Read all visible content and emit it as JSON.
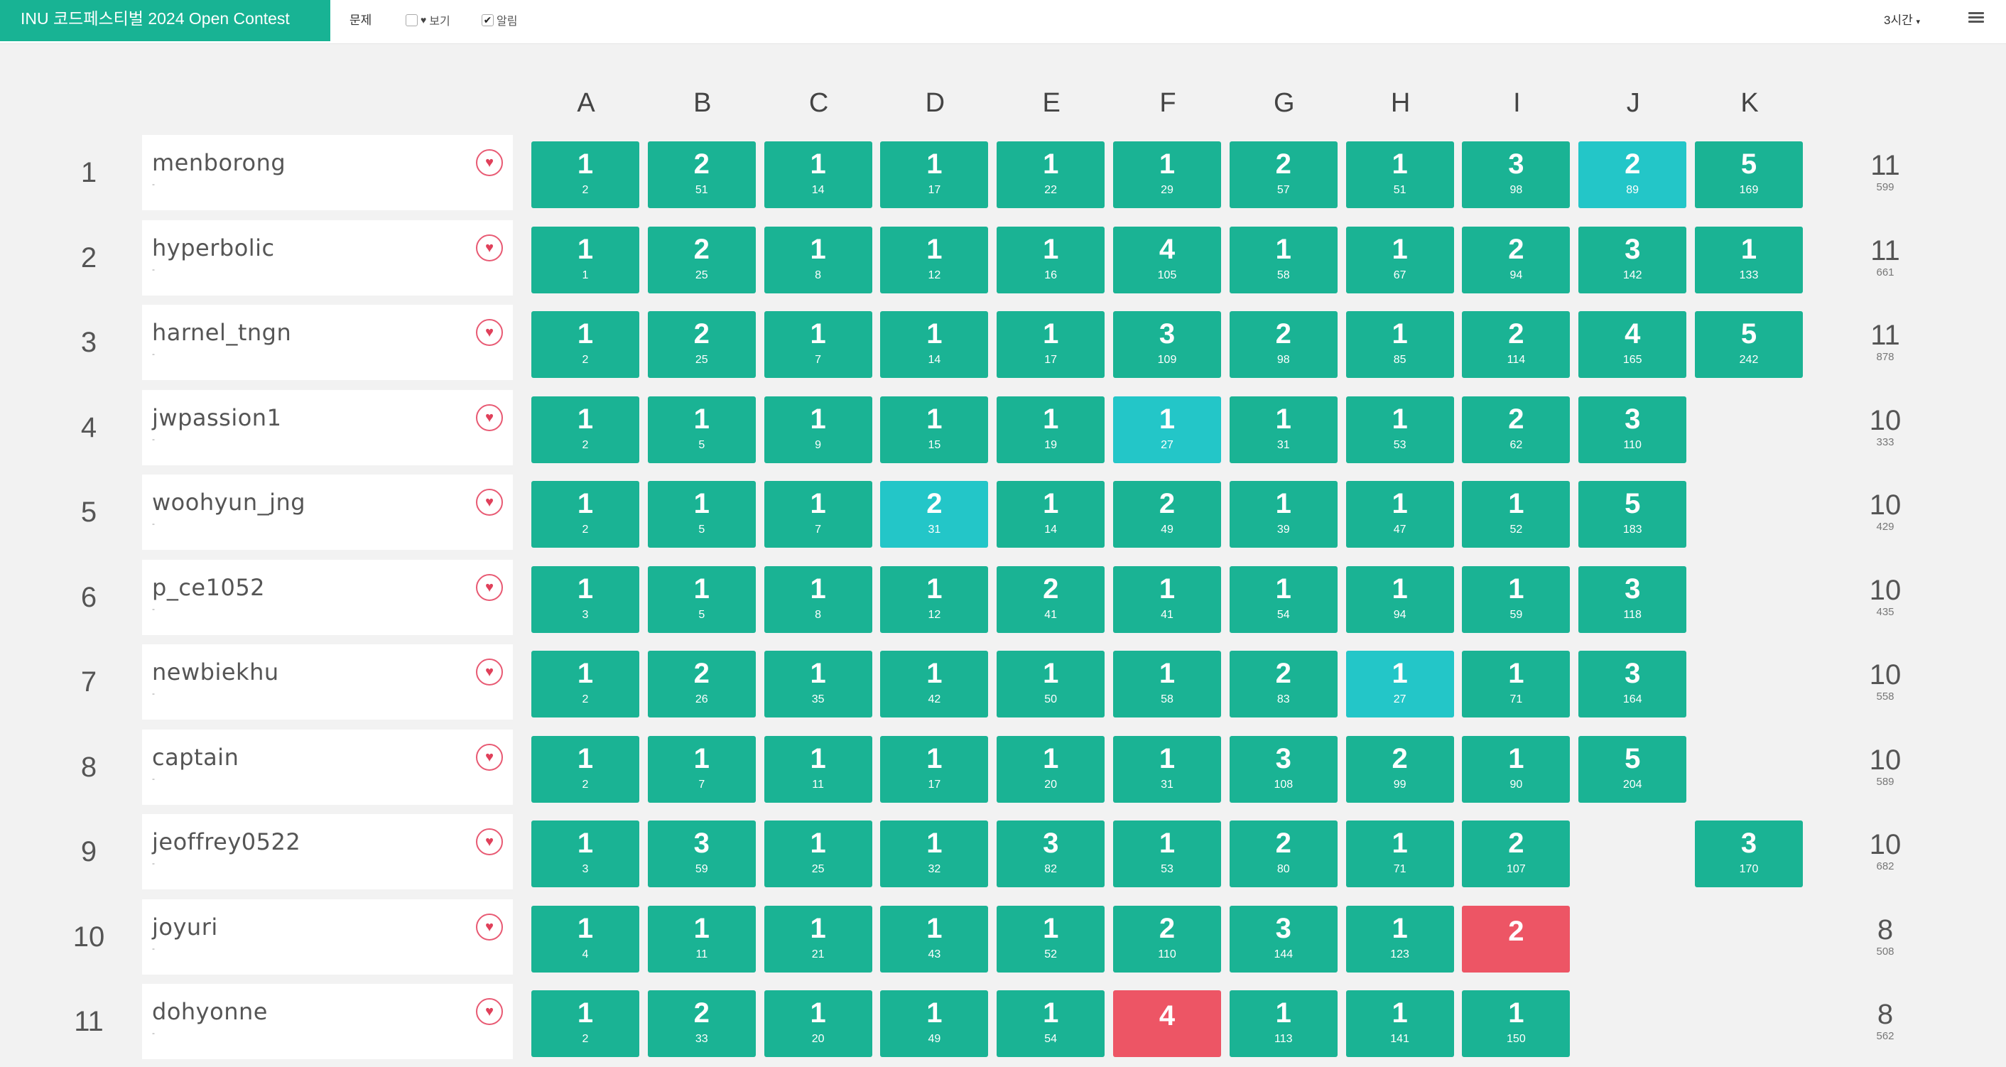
{
  "header": {
    "contest_title": "INU 코드페스티벌 2024 Open Contest",
    "problems_label": "문제",
    "favorite_view_label": "보기",
    "favorite_view_checked": false,
    "alert_label": "알림",
    "alert_checked": true,
    "time_dropdown": "3시간"
  },
  "columns": [
    "A",
    "B",
    "C",
    "D",
    "E",
    "F",
    "G",
    "H",
    "I",
    "J",
    "K"
  ],
  "colors": {
    "solved": "#1ab394",
    "first_solve": "#23c6c8",
    "failed": "#ed5565"
  },
  "rows": [
    {
      "rank": "1",
      "name": "menborong",
      "sub": "-",
      "solved": "11",
      "penalty": "599",
      "cells": [
        {
          "tries": "1",
          "time": "2",
          "status": "solved"
        },
        {
          "tries": "2",
          "time": "51",
          "status": "solved"
        },
        {
          "tries": "1",
          "time": "14",
          "status": "solved"
        },
        {
          "tries": "1",
          "time": "17",
          "status": "solved"
        },
        {
          "tries": "1",
          "time": "22",
          "status": "solved"
        },
        {
          "tries": "1",
          "time": "29",
          "status": "solved"
        },
        {
          "tries": "2",
          "time": "57",
          "status": "solved"
        },
        {
          "tries": "1",
          "time": "51",
          "status": "solved"
        },
        {
          "tries": "3",
          "time": "98",
          "status": "solved"
        },
        {
          "tries": "2",
          "time": "89",
          "status": "first"
        },
        {
          "tries": "5",
          "time": "169",
          "status": "solved"
        }
      ]
    },
    {
      "rank": "2",
      "name": "hyperbolic",
      "sub": "-",
      "solved": "11",
      "penalty": "661",
      "cells": [
        {
          "tries": "1",
          "time": "1",
          "status": "solved"
        },
        {
          "tries": "2",
          "time": "25",
          "status": "solved"
        },
        {
          "tries": "1",
          "time": "8",
          "status": "solved"
        },
        {
          "tries": "1",
          "time": "12",
          "status": "solved"
        },
        {
          "tries": "1",
          "time": "16",
          "status": "solved"
        },
        {
          "tries": "4",
          "time": "105",
          "status": "solved"
        },
        {
          "tries": "1",
          "time": "58",
          "status": "solved"
        },
        {
          "tries": "1",
          "time": "67",
          "status": "solved"
        },
        {
          "tries": "2",
          "time": "94",
          "status": "solved"
        },
        {
          "tries": "3",
          "time": "142",
          "status": "solved"
        },
        {
          "tries": "1",
          "time": "133",
          "status": "solved"
        }
      ]
    },
    {
      "rank": "3",
      "name": "harnel_tngn",
      "sub": "-",
      "solved": "11",
      "penalty": "878",
      "cells": [
        {
          "tries": "1",
          "time": "2",
          "status": "solved"
        },
        {
          "tries": "2",
          "time": "25",
          "status": "solved"
        },
        {
          "tries": "1",
          "time": "7",
          "status": "solved"
        },
        {
          "tries": "1",
          "time": "14",
          "status": "solved"
        },
        {
          "tries": "1",
          "time": "17",
          "status": "solved"
        },
        {
          "tries": "3",
          "time": "109",
          "status": "solved"
        },
        {
          "tries": "2",
          "time": "98",
          "status": "solved"
        },
        {
          "tries": "1",
          "time": "85",
          "status": "solved"
        },
        {
          "tries": "2",
          "time": "114",
          "status": "solved"
        },
        {
          "tries": "4",
          "time": "165",
          "status": "solved"
        },
        {
          "tries": "5",
          "time": "242",
          "status": "solved"
        }
      ]
    },
    {
      "rank": "4",
      "name": "jwpassion1",
      "sub": "-",
      "solved": "10",
      "penalty": "333",
      "cells": [
        {
          "tries": "1",
          "time": "2",
          "status": "solved"
        },
        {
          "tries": "1",
          "time": "5",
          "status": "solved"
        },
        {
          "tries": "1",
          "time": "9",
          "status": "solved"
        },
        {
          "tries": "1",
          "time": "15",
          "status": "solved"
        },
        {
          "tries": "1",
          "time": "19",
          "status": "solved"
        },
        {
          "tries": "1",
          "time": "27",
          "status": "first"
        },
        {
          "tries": "1",
          "time": "31",
          "status": "solved"
        },
        {
          "tries": "1",
          "time": "53",
          "status": "solved"
        },
        {
          "tries": "2",
          "time": "62",
          "status": "solved"
        },
        {
          "tries": "3",
          "time": "110",
          "status": "solved"
        },
        null
      ]
    },
    {
      "rank": "5",
      "name": "woohyun_jng",
      "sub": "-",
      "solved": "10",
      "penalty": "429",
      "cells": [
        {
          "tries": "1",
          "time": "2",
          "status": "solved"
        },
        {
          "tries": "1",
          "time": "5",
          "status": "solved"
        },
        {
          "tries": "1",
          "time": "7",
          "status": "solved"
        },
        {
          "tries": "2",
          "time": "31",
          "status": "first"
        },
        {
          "tries": "1",
          "time": "14",
          "status": "solved"
        },
        {
          "tries": "2",
          "time": "49",
          "status": "solved"
        },
        {
          "tries": "1",
          "time": "39",
          "status": "solved"
        },
        {
          "tries": "1",
          "time": "47",
          "status": "solved"
        },
        {
          "tries": "1",
          "time": "52",
          "status": "solved"
        },
        {
          "tries": "5",
          "time": "183",
          "status": "solved"
        },
        null
      ]
    },
    {
      "rank": "6",
      "name": "p_ce1052",
      "sub": "-",
      "solved": "10",
      "penalty": "435",
      "cells": [
        {
          "tries": "1",
          "time": "3",
          "status": "solved"
        },
        {
          "tries": "1",
          "time": "5",
          "status": "solved"
        },
        {
          "tries": "1",
          "time": "8",
          "status": "solved"
        },
        {
          "tries": "1",
          "time": "12",
          "status": "solved"
        },
        {
          "tries": "2",
          "time": "41",
          "status": "solved"
        },
        {
          "tries": "1",
          "time": "41",
          "status": "solved"
        },
        {
          "tries": "1",
          "time": "54",
          "status": "solved"
        },
        {
          "tries": "1",
          "time": "94",
          "status": "solved"
        },
        {
          "tries": "1",
          "time": "59",
          "status": "solved"
        },
        {
          "tries": "3",
          "time": "118",
          "status": "solved"
        },
        null
      ]
    },
    {
      "rank": "7",
      "name": "newbiekhu",
      "sub": "-",
      "solved": "10",
      "penalty": "558",
      "cells": [
        {
          "tries": "1",
          "time": "2",
          "status": "solved"
        },
        {
          "tries": "2",
          "time": "26",
          "status": "solved"
        },
        {
          "tries": "1",
          "time": "35",
          "status": "solved"
        },
        {
          "tries": "1",
          "time": "42",
          "status": "solved"
        },
        {
          "tries": "1",
          "time": "50",
          "status": "solved"
        },
        {
          "tries": "1",
          "time": "58",
          "status": "solved"
        },
        {
          "tries": "2",
          "time": "83",
          "status": "solved"
        },
        {
          "tries": "1",
          "time": "27",
          "status": "first"
        },
        {
          "tries": "1",
          "time": "71",
          "status": "solved"
        },
        {
          "tries": "3",
          "time": "164",
          "status": "solved"
        },
        null
      ]
    },
    {
      "rank": "8",
      "name": "captain",
      "sub": "-",
      "solved": "10",
      "penalty": "589",
      "cells": [
        {
          "tries": "1",
          "time": "2",
          "status": "solved"
        },
        {
          "tries": "1",
          "time": "7",
          "status": "solved"
        },
        {
          "tries": "1",
          "time": "11",
          "status": "solved"
        },
        {
          "tries": "1",
          "time": "17",
          "status": "solved"
        },
        {
          "tries": "1",
          "time": "20",
          "status": "solved"
        },
        {
          "tries": "1",
          "time": "31",
          "status": "solved"
        },
        {
          "tries": "3",
          "time": "108",
          "status": "solved"
        },
        {
          "tries": "2",
          "time": "99",
          "status": "solved"
        },
        {
          "tries": "1",
          "time": "90",
          "status": "solved"
        },
        {
          "tries": "5",
          "time": "204",
          "status": "solved"
        },
        null
      ]
    },
    {
      "rank": "9",
      "name": "jeoffrey0522",
      "sub": "-",
      "solved": "10",
      "penalty": "682",
      "cells": [
        {
          "tries": "1",
          "time": "3",
          "status": "solved"
        },
        {
          "tries": "3",
          "time": "59",
          "status": "solved"
        },
        {
          "tries": "1",
          "time": "25",
          "status": "solved"
        },
        {
          "tries": "1",
          "time": "32",
          "status": "solved"
        },
        {
          "tries": "3",
          "time": "82",
          "status": "solved"
        },
        {
          "tries": "1",
          "time": "53",
          "status": "solved"
        },
        {
          "tries": "2",
          "time": "80",
          "status": "solved"
        },
        {
          "tries": "1",
          "time": "71",
          "status": "solved"
        },
        {
          "tries": "2",
          "time": "107",
          "status": "solved"
        },
        null,
        {
          "tries": "3",
          "time": "170",
          "status": "solved"
        }
      ]
    },
    {
      "rank": "10",
      "name": "joyuri",
      "sub": "-",
      "solved": "8",
      "penalty": "508",
      "cells": [
        {
          "tries": "1",
          "time": "4",
          "status": "solved"
        },
        {
          "tries": "1",
          "time": "11",
          "status": "solved"
        },
        {
          "tries": "1",
          "time": "21",
          "status": "solved"
        },
        {
          "tries": "1",
          "time": "43",
          "status": "solved"
        },
        {
          "tries": "1",
          "time": "52",
          "status": "solved"
        },
        {
          "tries": "2",
          "time": "110",
          "status": "solved"
        },
        {
          "tries": "3",
          "time": "144",
          "status": "solved"
        },
        {
          "tries": "1",
          "time": "123",
          "status": "solved"
        },
        {
          "tries": "2",
          "time": "",
          "status": "failed"
        },
        null,
        null
      ]
    },
    {
      "rank": "11",
      "name": "dohyonne",
      "sub": "-",
      "solved": "8",
      "penalty": "562",
      "cells": [
        {
          "tries": "1",
          "time": "2",
          "status": "solved"
        },
        {
          "tries": "2",
          "time": "33",
          "status": "solved"
        },
        {
          "tries": "1",
          "time": "20",
          "status": "solved"
        },
        {
          "tries": "1",
          "time": "49",
          "status": "solved"
        },
        {
          "tries": "1",
          "time": "54",
          "status": "solved"
        },
        {
          "tries": "4",
          "time": "",
          "status": "failed"
        },
        {
          "tries": "1",
          "time": "113",
          "status": "solved"
        },
        {
          "tries": "1",
          "time": "141",
          "status": "solved"
        },
        {
          "tries": "1",
          "time": "150",
          "status": "solved"
        },
        null,
        null
      ]
    }
  ]
}
